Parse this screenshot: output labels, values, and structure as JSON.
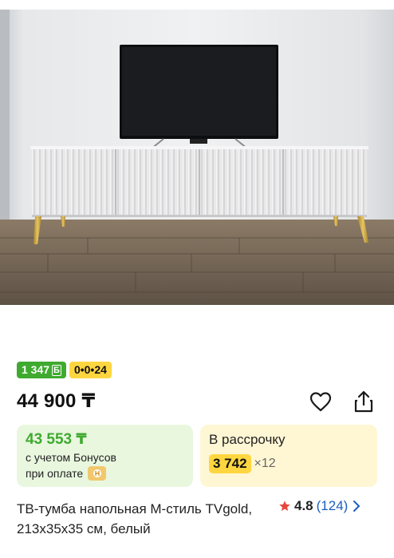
{
  "product": {
    "title": "ТВ-тумба напольная М-стиль TVgold, 213x35x35 см, белый",
    "price": "44 900 ₸"
  },
  "badges": {
    "bonus_amount": "1 347",
    "bonus_currency": "Б",
    "installment": "0•0•24"
  },
  "bonus_card": {
    "price": "43 553 ₸",
    "line1": "с учетом Бонусов",
    "line2": "при оплате"
  },
  "credit_card": {
    "title": "В рассрочку",
    "amount": "3 742",
    "months": "×12"
  },
  "rating": {
    "value": "4.8",
    "count": "(124)"
  },
  "icons": {
    "favorite": "heart-icon",
    "share": "share-icon",
    "star": "star-icon",
    "chevron": "chevron-right-icon",
    "pay": "wallet-icon"
  },
  "colors": {
    "accent_green": "#3faa2f",
    "accent_yellow": "#ffd640",
    "link_blue": "#1a5dbd",
    "star_red": "#e8463c"
  }
}
